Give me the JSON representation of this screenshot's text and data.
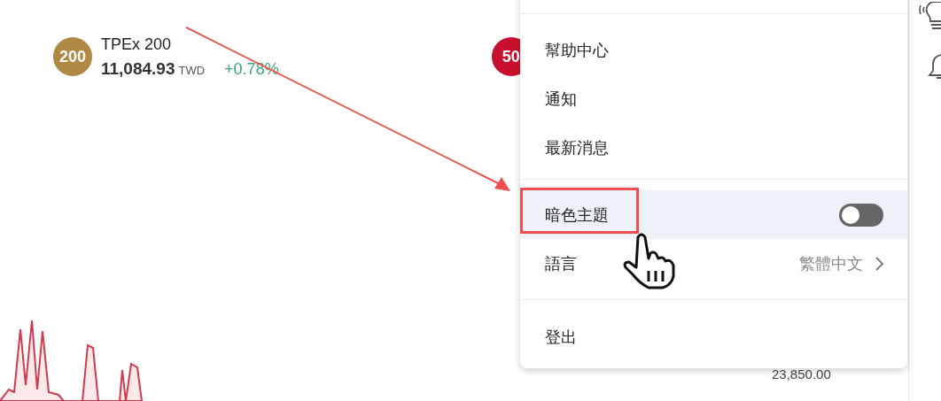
{
  "indices": [
    {
      "badge": "200",
      "color": "#b08a45",
      "name": "TPEx 200",
      "value": "11,084.93",
      "currency": "TWD",
      "change": "+0.78%"
    },
    {
      "badge": "50",
      "color": "#c8102e"
    }
  ],
  "background_value": "23,850.00",
  "menu": {
    "sections": [
      [
        {
          "kind": "link",
          "label": "幫助中心",
          "selected": false
        },
        {
          "kind": "link",
          "label": "通知",
          "selected": false
        },
        {
          "kind": "link",
          "label": "最新消息",
          "selected": false
        }
      ],
      [
        {
          "kind": "toggle",
          "label": "暗色主題",
          "on": false,
          "selected": true
        },
        {
          "kind": "submenu",
          "label": "語言",
          "value": "繁體中文",
          "selected": false
        }
      ],
      [
        {
          "kind": "link",
          "label": "登出",
          "selected": false
        }
      ]
    ]
  }
}
